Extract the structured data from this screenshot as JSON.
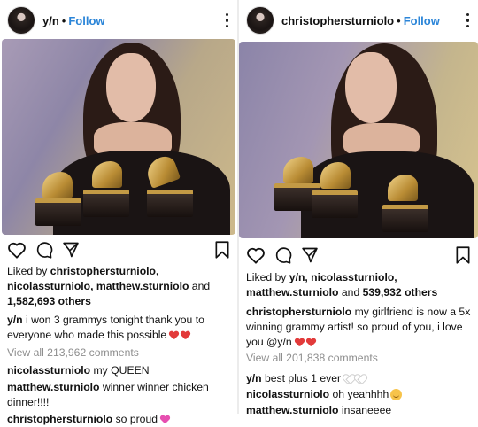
{
  "left": {
    "username": "y/n",
    "follow": "Follow",
    "separator": "•",
    "likes": {
      "prefix": "Liked by",
      "u1": "christophersturniolo,",
      "u2": "nicolassturniolo, matthew.sturniolo",
      "and": "and",
      "count": "1,582,693 others"
    },
    "caption": {
      "user": "y/n",
      "text": "i won 3 grammys tonight thank you to everyone who made this possible"
    },
    "view_comments": {
      "prefix": "View all",
      "count": "213,962",
      "suffix": "comments"
    },
    "comments": [
      {
        "user": "nicolassturniolo",
        "text": "my QUEEN"
      },
      {
        "user": "matthew.sturniolo",
        "text": "winner winner chicken dinner!!!!"
      },
      {
        "user": "christophersturniolo",
        "text": "so proud"
      }
    ]
  },
  "right": {
    "username": "christophersturniolo",
    "follow": "Follow",
    "separator": "•",
    "likes": {
      "prefix": "Liked by",
      "u1": "y/n, nicolassturniolo,",
      "u2": "matthew.sturniolo",
      "and": "and",
      "count": "539,932 others"
    },
    "caption": {
      "user": "christophersturniolo",
      "text": "my girlfriend is now a 5x winning grammy artist! so proud of you, i love you @y/n"
    },
    "view_comments": {
      "prefix": "View all",
      "count": "201,838",
      "suffix": "comments"
    },
    "comments": [
      {
        "user": "y/n",
        "text": "best plus 1 ever"
      },
      {
        "user": "nicolassturniolo",
        "text": "oh yeahhhh"
      },
      {
        "user": "matthew.sturniolo",
        "text": "insaneeee"
      }
    ]
  },
  "icons": [
    "heart-icon",
    "comment-icon",
    "share-icon",
    "bookmark-icon",
    "more-options-icon",
    "heart-emoji",
    "smile-emoji"
  ],
  "colors": {
    "follow": "#2b85d8",
    "muted": "#8e8e8e",
    "heart_red": "#e23a3a",
    "heart_pink": "#e64fb0"
  }
}
